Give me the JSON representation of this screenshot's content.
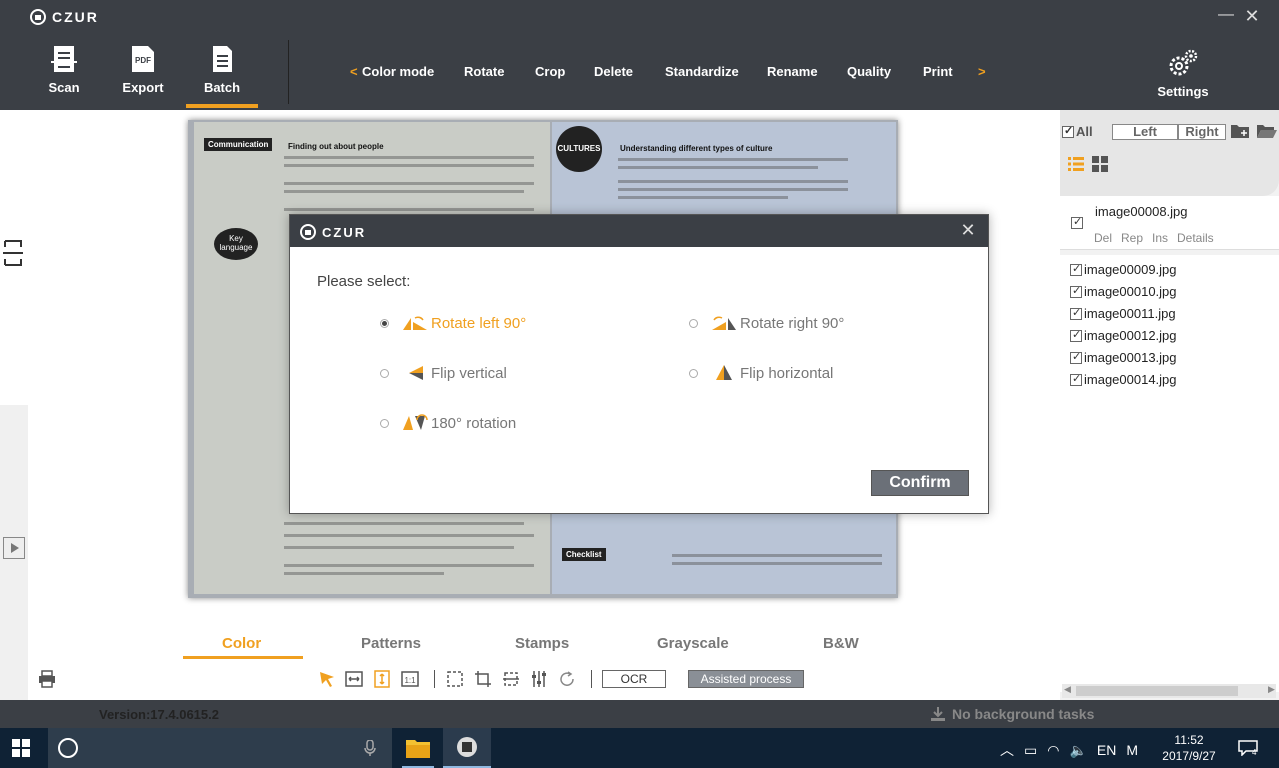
{
  "app": {
    "title": "CZUR",
    "version": "Version:17.4.0615.2",
    "bg_tasks": "No background tasks"
  },
  "toolbar": {
    "scan": "Scan",
    "export": "Export",
    "batch": "Batch",
    "settings": "Settings",
    "export_icon_text": "PDF",
    "menu_prev": "<",
    "menu_next": ">",
    "menu": [
      "Color mode",
      "Rotate",
      "Crop",
      "Delete",
      "Standardize",
      "Rename",
      "Quality",
      "Print"
    ]
  },
  "book": {
    "comm": "Communication",
    "head_left": "Finding out about people",
    "head_right": "Understanding different types of culture",
    "cultures": "CULTURES",
    "key_language": "Key language",
    "checklist": "Checklist"
  },
  "color_tabs": [
    "Color",
    "Patterns",
    "Stamps",
    "Grayscale",
    "B&W"
  ],
  "tools": {
    "ocr": "OCR",
    "assisted": "Assisted process"
  },
  "right_panel": {
    "all": "All",
    "left": "Left",
    "right": "Right",
    "selected_file": "image00008.jpg",
    "file_actions": [
      "Del",
      "Rep",
      "Ins",
      "Details"
    ],
    "files": [
      "image00009.jpg",
      "image00010.jpg",
      "image00011.jpg",
      "image00012.jpg",
      "image00013.jpg",
      "image00014.jpg"
    ]
  },
  "dialog": {
    "title": "CZUR",
    "prompt": "Please select:",
    "options": {
      "rotate_left": "Rotate left 90°",
      "rotate_right": "Rotate right 90°",
      "flip_vertical": "Flip vertical",
      "flip_horizontal": "Flip horizontal",
      "rotate_180": "180° rotation"
    },
    "selected": "rotate_left",
    "confirm": "Confirm"
  },
  "taskbar": {
    "lang": "EN",
    "ime": "M",
    "time": "11:52",
    "date": "2017/9/27",
    "notifications": "4"
  },
  "colors": {
    "accent": "#f0a020",
    "chrome": "#3b3f45",
    "taskbar": "#0f2235"
  }
}
